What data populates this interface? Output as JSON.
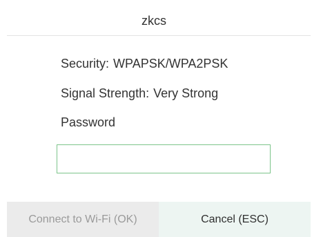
{
  "dialog": {
    "title": "zkcs",
    "security": {
      "label": "Security:",
      "value": "WPAPSK/WPA2PSK"
    },
    "signal": {
      "label": "Signal Strength:",
      "value": "Very Strong"
    },
    "password": {
      "label": "Password",
      "value": "",
      "placeholder": ""
    },
    "buttons": {
      "connect_label": "Connect to Wi-Fi (OK)",
      "cancel_label": "Cancel (ESC)"
    }
  },
  "colors": {
    "input_border": "#7cc48a",
    "connect_bg": "#ebebeb",
    "connect_text": "#9a9a9a",
    "cancel_bg": "#edf5f2",
    "text": "#333333"
  }
}
